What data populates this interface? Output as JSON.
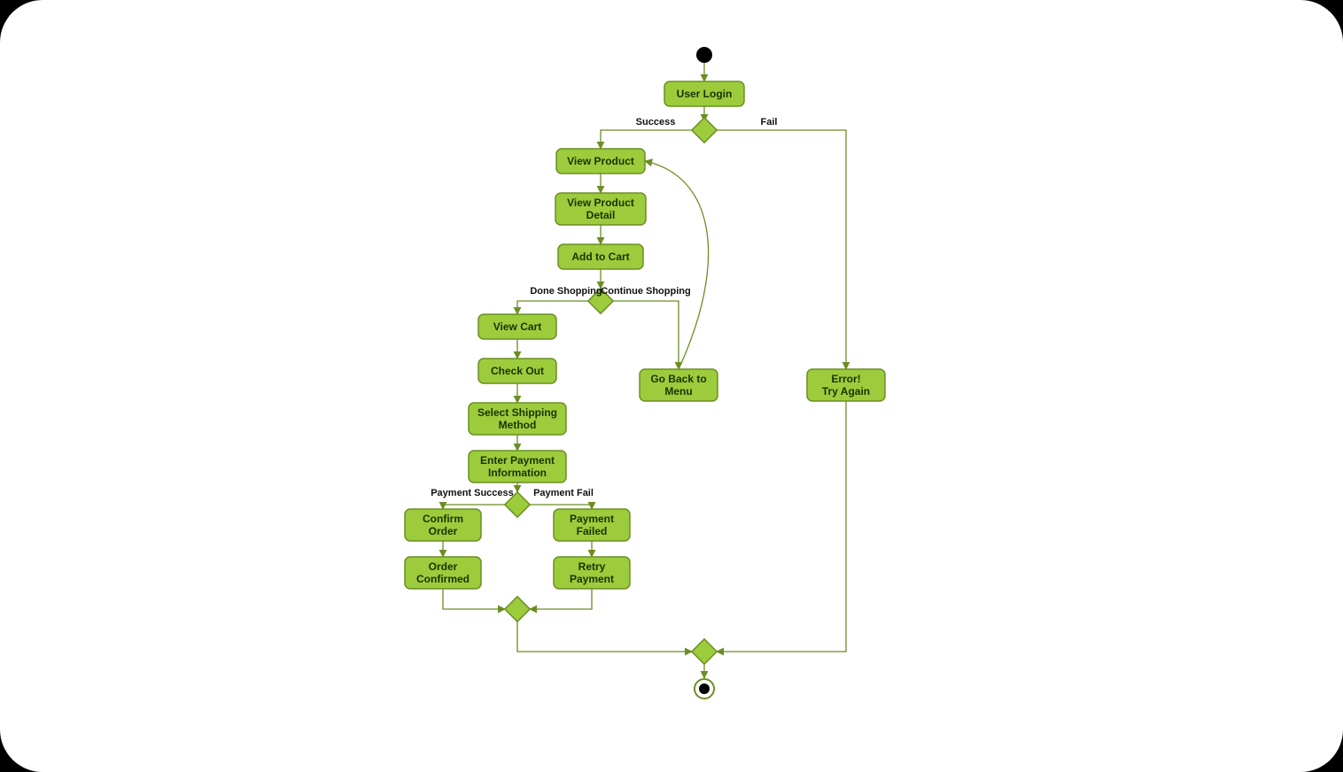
{
  "diagram": {
    "type": "activity-diagram",
    "nodes": {
      "user_login": {
        "label": "User Login"
      },
      "view_product": {
        "label": "View Product"
      },
      "view_detail": {
        "line1": "View Product",
        "line2": "Detail"
      },
      "add_cart": {
        "label": "Add to Cart"
      },
      "view_cart": {
        "label": "View Cart"
      },
      "check_out": {
        "label": "Check Out"
      },
      "select_ship": {
        "line1": "Select Shipping",
        "line2": "Method"
      },
      "enter_pay": {
        "line1": "Enter Payment",
        "line2": "Information"
      },
      "confirm_order": {
        "line1": "Confirm",
        "line2": "Order"
      },
      "order_confirmed": {
        "line1": "Order",
        "line2": "Confirmed"
      },
      "payment_failed": {
        "line1": "Payment",
        "line2": "Failed"
      },
      "retry_payment": {
        "line1": "Retry",
        "line2": "Payment"
      },
      "go_back_menu": {
        "line1": "Go Back to",
        "line2": "Menu"
      },
      "error_try": {
        "line1": "Error!",
        "line2": "Try Again"
      }
    },
    "edge_labels": {
      "login_success": "Success",
      "login_fail": "Fail",
      "done_shopping": "Done Shopping",
      "continue_shopping": "Continue Shopping",
      "payment_success": "Payment Success",
      "payment_fail": "Payment Fail"
    },
    "colors": {
      "node_fill": "#9ccc3c",
      "node_stroke": "#6b8e23",
      "text": "#1a3300"
    }
  }
}
